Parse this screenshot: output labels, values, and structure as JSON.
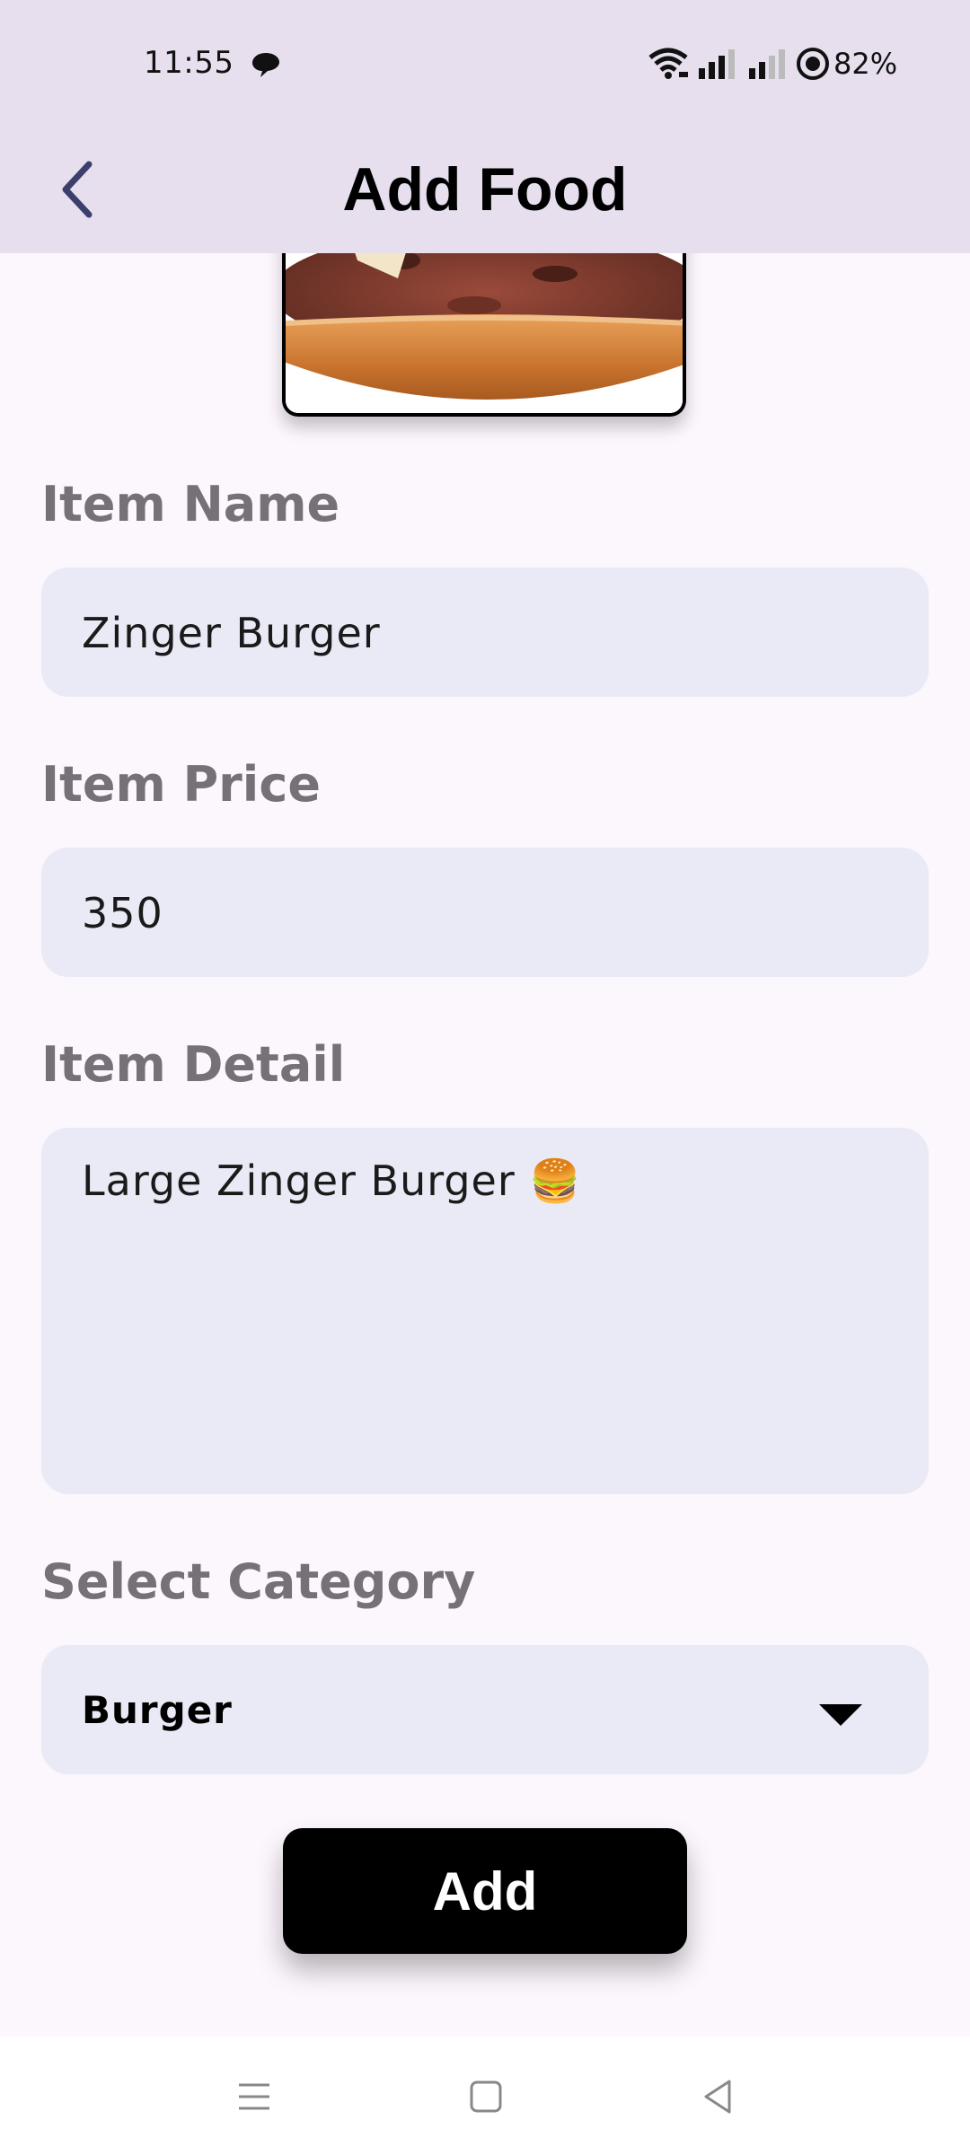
{
  "status_bar": {
    "time": "11:55",
    "battery": "82%",
    "icons": [
      "notification-icon",
      "wifi-icon",
      "signal-icon",
      "signal-icon",
      "battery-icon"
    ]
  },
  "app_bar": {
    "title": "Add Food",
    "back_icon": "chevron-left-icon"
  },
  "form": {
    "name_label": "Item Name",
    "name_value": "Zinger Burger",
    "price_label": "Item Price",
    "price_value": "350",
    "detail_label": "Item Detail",
    "detail_value": "Large Zinger Burger 🍔",
    "category_label": "Select Category",
    "category_value": "Burger",
    "submit_label": "Add"
  },
  "nav_bar": {
    "icons": [
      "menu-icon",
      "home-icon",
      "back-icon"
    ]
  },
  "colors": {
    "app_bar_bg": "#e7dfee",
    "page_bg": "#fcf6fd",
    "field_bg": "#eaeaf6",
    "label_color": "#777079",
    "button_bg": "#000000"
  }
}
